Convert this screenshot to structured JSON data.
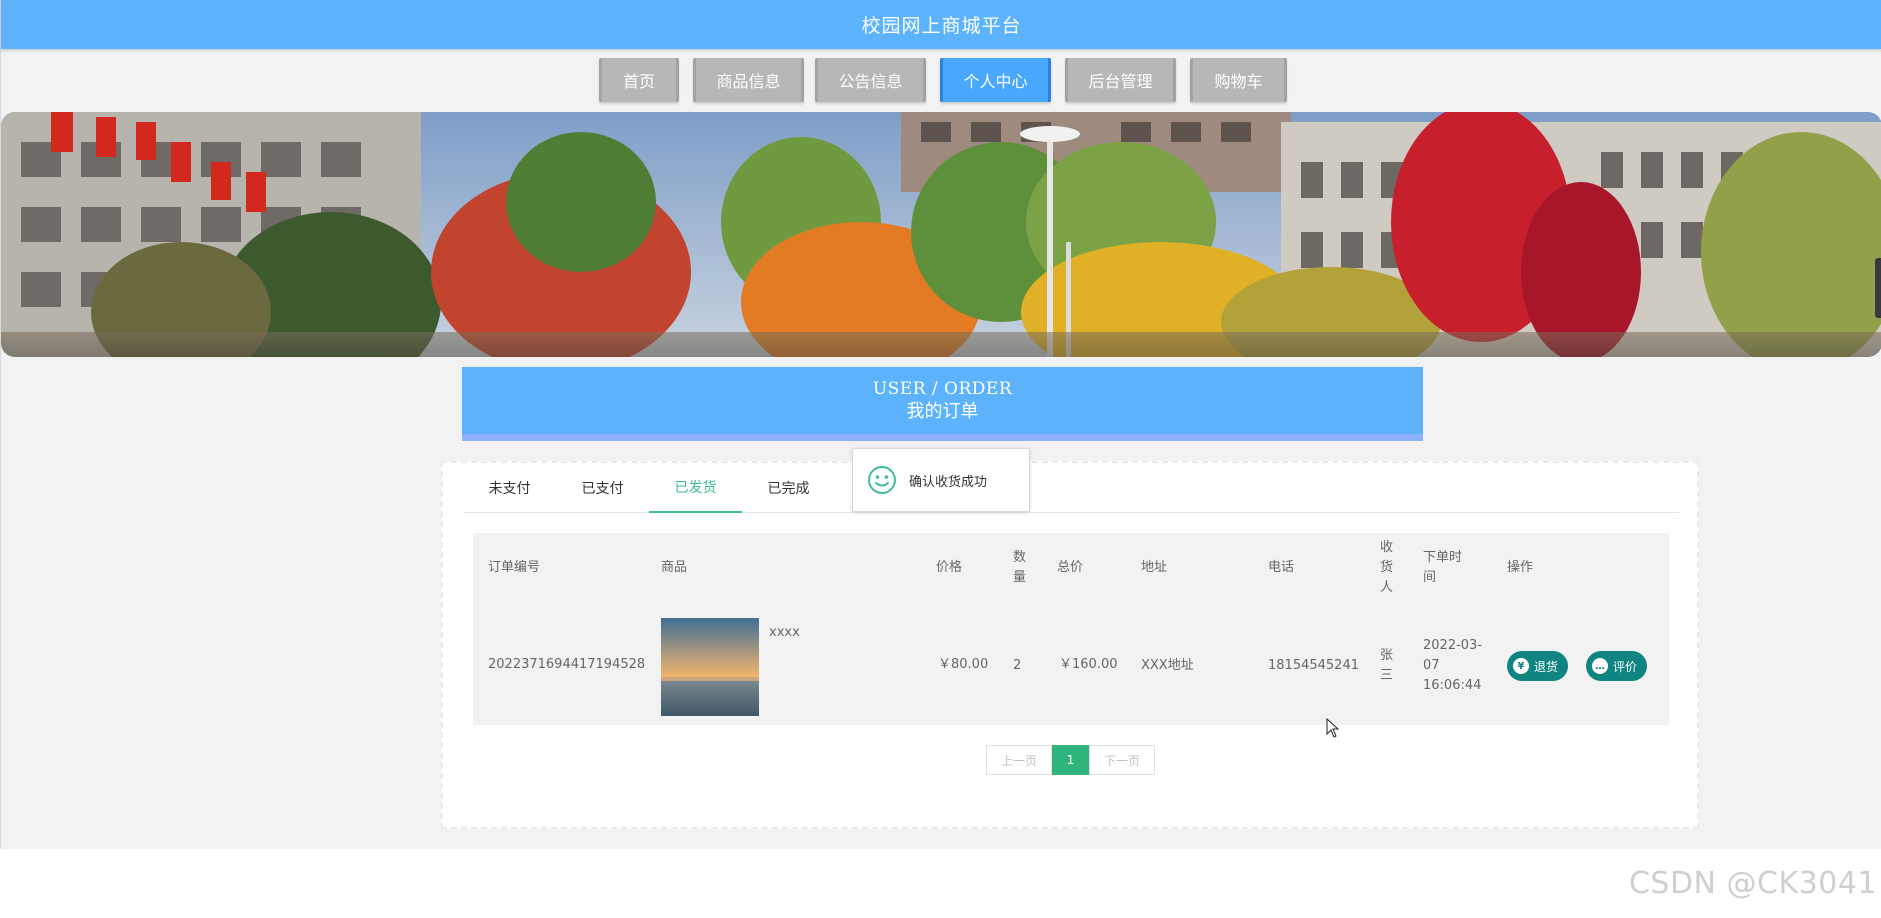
{
  "app": {
    "title": "校园网上商城平台"
  },
  "nav": {
    "items": [
      {
        "label": "首页"
      },
      {
        "label": "商品信息"
      },
      {
        "label": "公告信息"
      },
      {
        "label": "个人中心",
        "active": true
      },
      {
        "label": "后台管理"
      },
      {
        "label": "购物车"
      }
    ]
  },
  "section": {
    "title_en": "USER / ORDER",
    "title_cn": "我的订单"
  },
  "tabs": [
    {
      "label": "未支付"
    },
    {
      "label": "已支付"
    },
    {
      "label": "已发货",
      "active": true
    },
    {
      "label": "已完成"
    }
  ],
  "toast": {
    "message": "确认收货成功",
    "icon": "smile-icon"
  },
  "table": {
    "headers": {
      "order_no": "订单编号",
      "product": "商品",
      "price": "价格",
      "qty": "数量",
      "total": "总价",
      "address": "地址",
      "phone": "电话",
      "receiver": "收货人",
      "time": "下单时间",
      "ops": "操作"
    },
    "rows": [
      {
        "order_no": "2022371694417194528",
        "product_name": "xxxx",
        "price": "￥80.00",
        "qty": "2",
        "total": "￥160.00",
        "address": "XXX地址",
        "phone": "18154545241",
        "receiver": "张三",
        "time": "2022-03-07 16:06:44",
        "actions": {
          "refund": "退货",
          "review": "评价"
        }
      }
    ]
  },
  "pager": {
    "prev": "上一页",
    "current": "1",
    "next": "下一页"
  },
  "watermark": "CSDN @CK3041",
  "colors": {
    "topbar": "#5cb3fc",
    "nav_active": "#49a8fb",
    "tab_active": "#3fbf8f",
    "action_btn": "#0f8582",
    "page_current": "#2fb47c"
  }
}
